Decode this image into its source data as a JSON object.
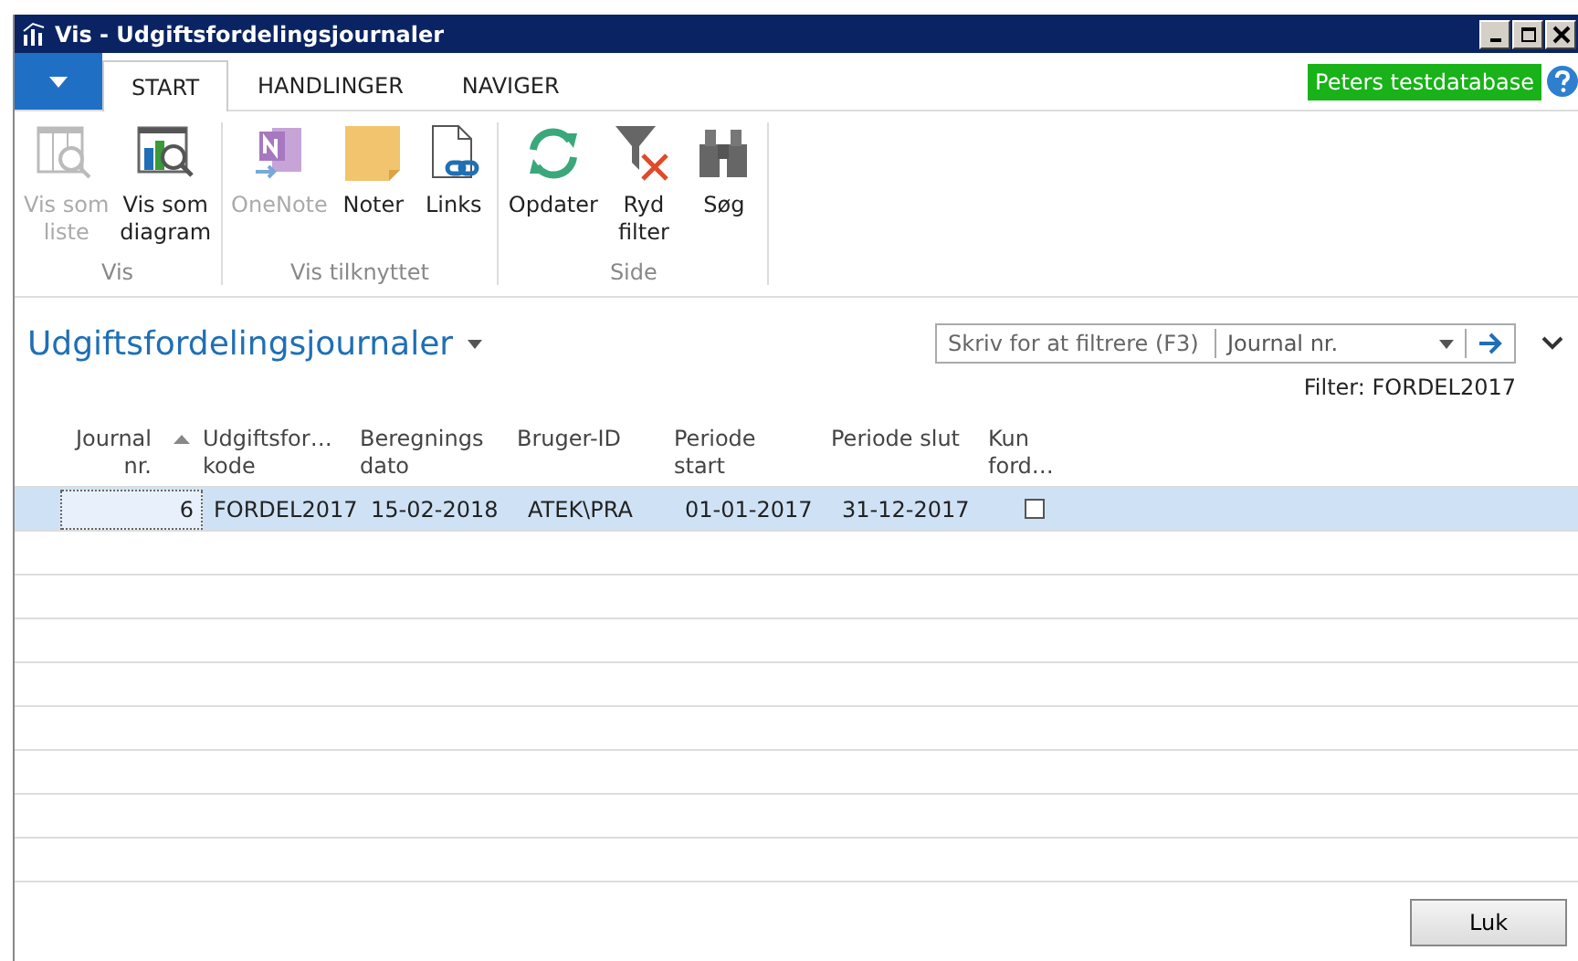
{
  "window": {
    "title": "Vis - Udgiftsfordelingsjournaler"
  },
  "tabs": [
    {
      "label": "START",
      "selected": true
    },
    {
      "label": "HANDLINGER",
      "selected": false
    },
    {
      "label": "NAVIGER",
      "selected": false
    }
  ],
  "database_badge": "Peters testdatabase",
  "ribbon": [
    {
      "label": "Vis",
      "buttons": [
        {
          "kind": "list",
          "lines": [
            "Vis som",
            "liste"
          ],
          "disabled": true
        },
        {
          "kind": "chart",
          "lines": [
            "Vis som",
            "diagram"
          ],
          "disabled": false
        }
      ]
    },
    {
      "label": "Vis tilknyttet",
      "buttons": [
        {
          "kind": "onenote",
          "lines": [
            "OneNote"
          ],
          "disabled": true
        },
        {
          "kind": "note",
          "lines": [
            "Noter"
          ],
          "disabled": false
        },
        {
          "kind": "link",
          "lines": [
            "Links"
          ],
          "disabled": false
        }
      ]
    },
    {
      "label": "Side",
      "buttons": [
        {
          "kind": "refresh",
          "lines": [
            "Opdater"
          ],
          "disabled": false
        },
        {
          "kind": "clearfilter",
          "lines": [
            "Ryd",
            "filter"
          ],
          "disabled": false
        },
        {
          "kind": "find",
          "lines": [
            "Søg"
          ],
          "disabled": false
        }
      ]
    }
  ],
  "page_title": "Udgiftsfordelingsjournaler",
  "search": {
    "placeholder": "Skriv for at filtrere (F3)",
    "field": "Journal nr."
  },
  "filter": "Filter: FORDEL2017",
  "table": {
    "columns": [
      {
        "lines": [
          "Journal",
          "nr."
        ],
        "right_aligned": true,
        "sorted": true
      },
      {
        "lines": [
          "Udgiftsfor…",
          "kode"
        ],
        "right_aligned": false,
        "sorted": false
      },
      {
        "lines": [
          "Beregnings",
          "dato"
        ],
        "right_aligned": false,
        "sorted": false
      },
      {
        "lines": [
          "Bruger-ID"
        ],
        "right_aligned": false,
        "sorted": false
      },
      {
        "lines": [
          "Periode",
          "start"
        ],
        "right_aligned": false,
        "sorted": false
      },
      {
        "lines": [
          "Periode slut"
        ],
        "right_aligned": false,
        "sorted": false
      },
      {
        "lines": [
          "Kun",
          "ford…"
        ],
        "right_aligned": false,
        "sorted": false
      }
    ],
    "rows": [
      {
        "selected": true,
        "cells": [
          "6",
          "FORDEL2017",
          "15-02-2018",
          "ATEK\\PRA",
          "01-01-2017",
          "31-12-2017"
        ],
        "checked": false
      }
    ]
  },
  "buttons": [
    "Luk"
  ]
}
